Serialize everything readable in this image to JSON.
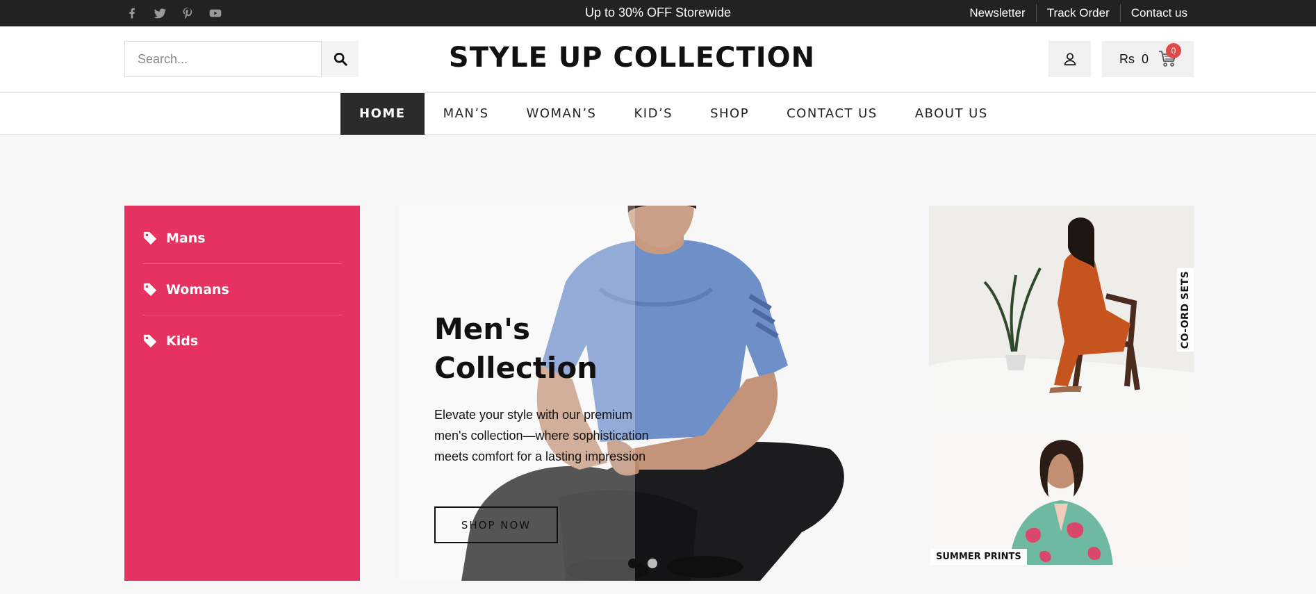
{
  "topbar": {
    "social": [
      "facebook-icon",
      "twitter-icon",
      "pinterest-icon",
      "youtube-icon"
    ],
    "promo": "Up to 30% OFF Storewide",
    "links": [
      "Newsletter",
      "Track Order",
      "Contact us"
    ]
  },
  "header": {
    "search_placeholder": "Search...",
    "brand": "STYLE UP COLLECTION",
    "cart_currency": "Rs",
    "cart_amount": "0",
    "cart_count": "0"
  },
  "nav": {
    "items": [
      "HOME",
      "MAN’S",
      "WOMAN’S",
      "KID’S",
      "SHOP",
      "CONTACT US",
      "ABOUT US"
    ],
    "active": "HOME"
  },
  "categories": [
    "Mans",
    "Womans",
    "Kids"
  ],
  "hero": {
    "title_line1": "Men's",
    "title_line2": "Collection",
    "text": "Elevate your style with our premium men's collection—where sophistication meets comfort for a lasting impression",
    "button": "SHOP NOW",
    "slides": 2,
    "active_slide": 1
  },
  "tiles": {
    "top_label": "CO-ORD SETS",
    "bottom_label": "SUMMER PRINTS"
  },
  "colors": {
    "topbar": "#222222",
    "accent": "#e63261",
    "nav_active": "#2b2b2b",
    "badge": "#e04a4a"
  }
}
